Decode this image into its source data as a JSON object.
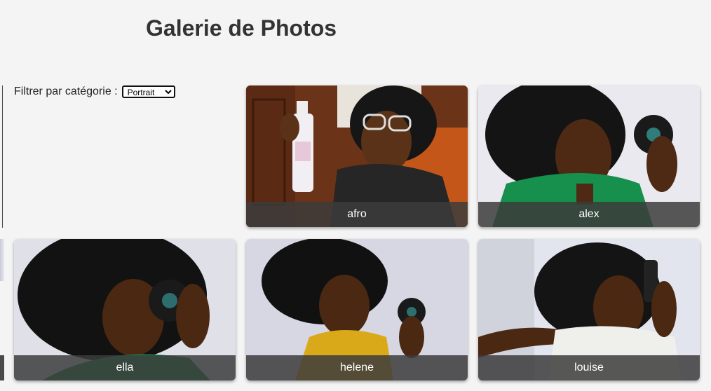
{
  "page": {
    "title": "Galerie de Photos"
  },
  "filter": {
    "label": "Filtrer par catégorie :",
    "selected": "Portrait"
  },
  "gallery": {
    "items": [
      {
        "caption": "afro",
        "palette": {
          "bg": "#7a3a1a",
          "accent": "#c15a1c",
          "shirt": "#222222"
        }
      },
      {
        "caption": "alex",
        "palette": {
          "bg": "#e8e8ee",
          "accent": "#1f9a55",
          "shirt": "#16904c"
        }
      },
      {
        "caption": "ella",
        "palette": {
          "bg": "#dfe0e8",
          "accent": "#1a8d49",
          "shirt": "#17884a"
        }
      },
      {
        "caption": "helene",
        "palette": {
          "bg": "#d8d8e4",
          "accent": "#e3b321",
          "shirt": "#d9a91a"
        }
      },
      {
        "caption": "louise",
        "palette": {
          "bg": "#e4e6ee",
          "accent": "#f2f2f0",
          "shirt": "#efefec"
        }
      }
    ]
  }
}
